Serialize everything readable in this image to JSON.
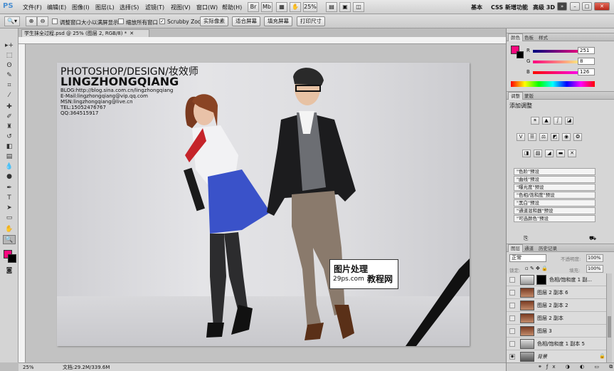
{
  "app": {
    "logo": "PS"
  },
  "menu": [
    "文件(F)",
    "编辑(E)",
    "图像(I)",
    "图层(L)",
    "选择(S)",
    "滤镜(T)",
    "视图(V)",
    "窗口(W)",
    "帮助(H)"
  ],
  "zoom_select": "25%",
  "workspaces": [
    "基本",
    "CSS 新增功能",
    "高级 3D"
  ],
  "workspace_more": "»",
  "options": {
    "chk_fit": "调整窗口大小以满屏显示",
    "chk_all": "缩放所有窗口",
    "chk_scrubby": "Scrubby Zoom",
    "btn_actual": "实际像素",
    "btn_fit": "适合屏幕",
    "btn_fill": "填充屏幕",
    "btn_print": "打印尺寸"
  },
  "document": {
    "tab": "学生抹全过程.psd @ 25% (图层 2, RGB/8) *"
  },
  "photo": {
    "line1": "PHOTOSHOP/DESIGN/妆效师",
    "line2": "LINGZHONGQIANG",
    "blog": "BLOG:http://blog.sina.com.cn/lingzhongqiang",
    "email": "E-Mail:lingzhongqiang@vip.qq.com",
    "msn": "MSN:lingzhongqiang@live.cn",
    "tel": "TEL:15052476767",
    "qq": "QQ:364515917"
  },
  "watermark": {
    "line1": "图片处理",
    "line2": "29ps.com",
    "line3": "教程网"
  },
  "status": {
    "zoom": "25%",
    "doc": "文档:29.2M/339.6M"
  },
  "color_panel": {
    "tabs": [
      "颜色",
      "色板",
      "样式"
    ],
    "r_label": "R",
    "g_label": "G",
    "b_label": "B",
    "r": "251",
    "g": "8",
    "b": "126",
    "fg_color": "#fb087e"
  },
  "adjust_panel": {
    "tabs": [
      "调整",
      "蒙版"
    ],
    "title": "添加调整",
    "presets": [
      "\"色阶\"预设",
      "\"曲线\"预设",
      "\"曝光度\"预设",
      "\"色相/饱和度\"预设",
      "\"黑白\"预设",
      "\"通道混和器\"预设",
      "\"可选颜色\"预设"
    ]
  },
  "layers_panel": {
    "tabs": [
      "图层",
      "通道",
      "历史记录"
    ],
    "blend": "正常",
    "opacity_label": "不透明度:",
    "opacity": "100%",
    "lock_label": "锁定:",
    "fill_label": "填充:",
    "fill": "100%",
    "layers": [
      {
        "name": "色相/饱和度 1 副..."
      },
      {
        "name": "图层 2 副本 6"
      },
      {
        "name": "图层 2 副本 2"
      },
      {
        "name": "图层 2 副本"
      },
      {
        "name": "图层 3"
      },
      {
        "name": "色相/饱和度 1 副本 5"
      },
      {
        "name": "背景"
      }
    ]
  }
}
